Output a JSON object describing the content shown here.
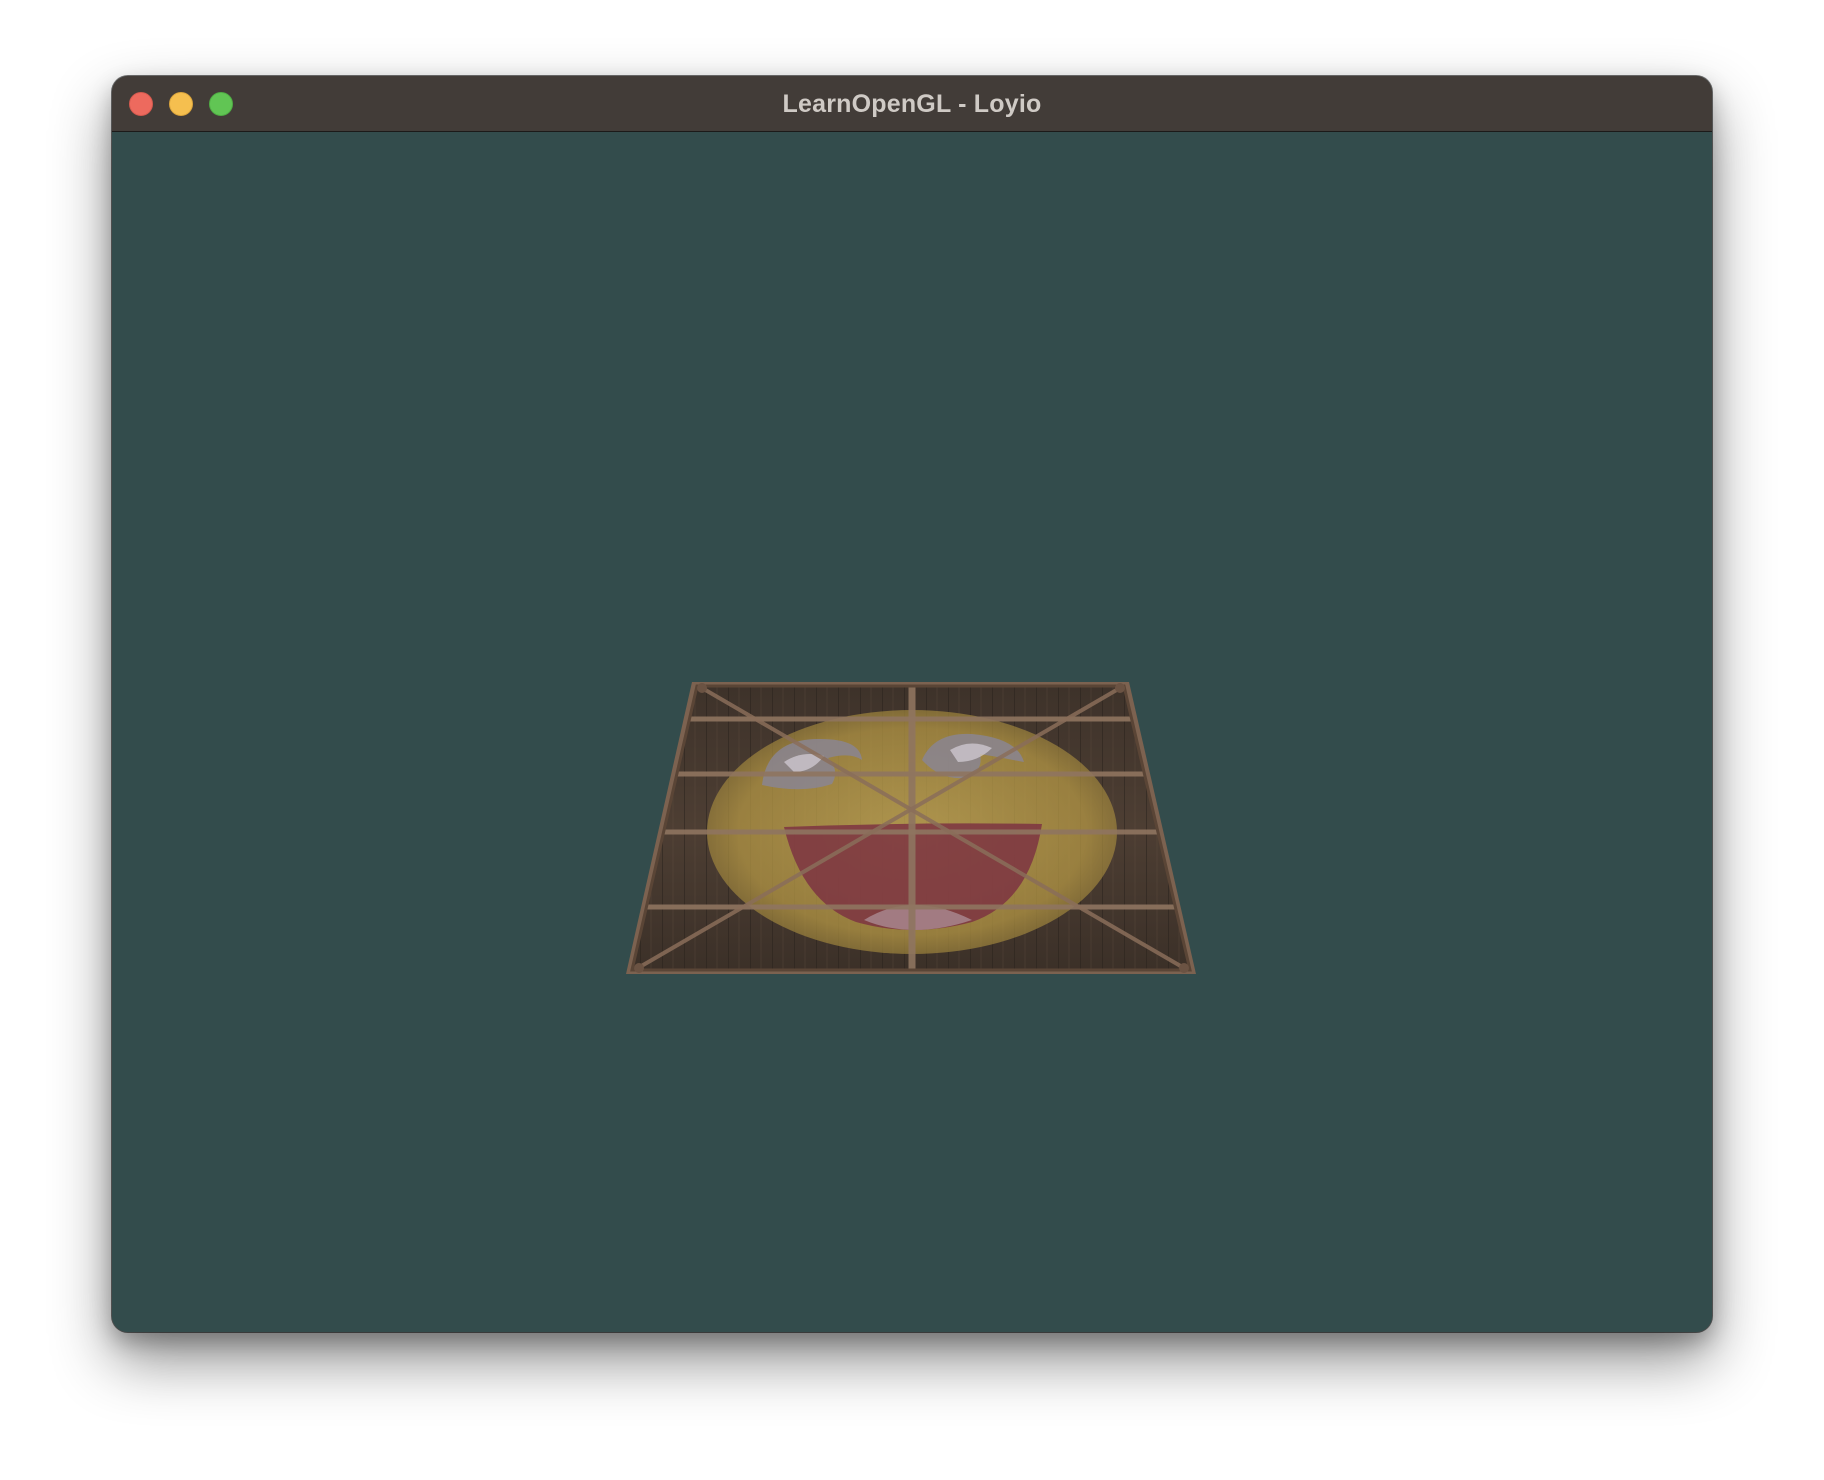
{
  "window": {
    "title": "LearnOpenGL - Loyio",
    "controls": {
      "close": "close-button",
      "minimize": "minimize-button",
      "zoom": "zoom-button"
    }
  },
  "viewport": {
    "clear_color": "#334c4c",
    "object": {
      "description_icon": "textured-quad",
      "textures": [
        "wooden-container",
        "awesome-face"
      ]
    }
  },
  "colors": {
    "titlebar": "#423c38",
    "close": "#ed6a5e",
    "minimize": "#f5bf4f",
    "zoom": "#61c554",
    "wood_dark": "#3a2e26",
    "wood_mid": "#5c4a3a",
    "metal_frame": "#7a5f4c",
    "face_yellow": "#c8a94a",
    "mouth_red": "#8a3a45"
  }
}
